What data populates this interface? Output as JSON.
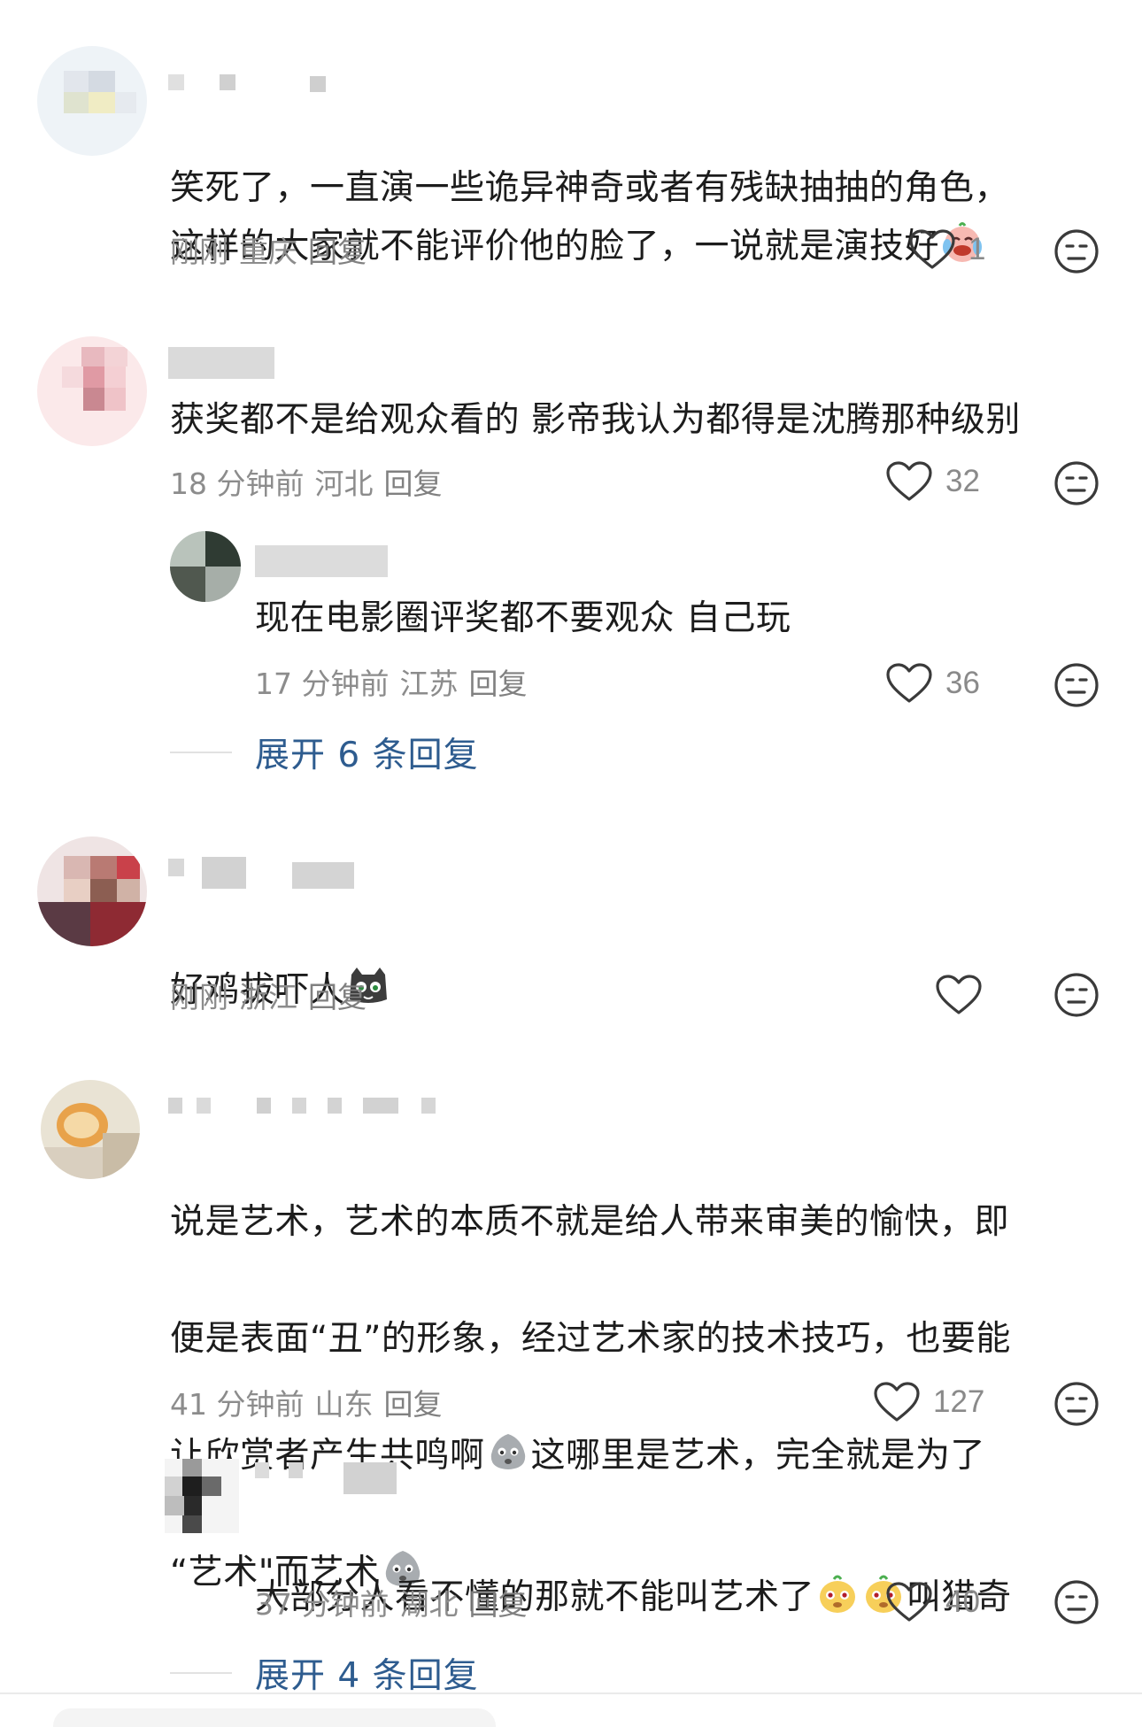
{
  "comments": [
    {
      "text": "笑死了，一直演一些诡异神奇或者有残缺抽抽的角色，\n这样的大家就不能评价他的脸了，一说就是演技好",
      "time": "刚刚",
      "location": "重庆",
      "reply_label": "回复",
      "likes": "1",
      "emoji": "crying-laugh-icon"
    },
    {
      "text": "获奖都不是给观众看的 影帝我认为都得是沈腾那种级别",
      "time": "18 分钟前",
      "location": "河北",
      "reply_label": "回复",
      "likes": "32",
      "reply": {
        "text": "现在电影圈评奖都不要观众 自己玩",
        "time": "17 分钟前",
        "location": "江苏",
        "reply_label": "回复",
        "likes": "36"
      },
      "expand_label": "展开 6 条回复"
    },
    {
      "text": "好鸡拔吓人",
      "time": "刚刚",
      "location": "浙江",
      "reply_label": "回复",
      "likes": "",
      "emoji": "cat-face-icon"
    },
    {
      "text_lines": [
        "说是艺术，艺术的本质不就是给人带来审美的愉快，即",
        "便是表面“丑”的形象，经过艺术家的技术技巧，也要能",
        "让欣赏者产生共鸣啊",
        "这哪里是艺术，完全就是为了",
        "“艺术\"而艺术"
      ],
      "time": "41 分钟前",
      "location": "山东",
      "reply_label": "回复",
      "likes": "127",
      "emoji": "gray-blob-icon",
      "reply": {
        "text_a": "大部分人看不懂的那就不能叫艺术了",
        "text_b": "叫猎奇",
        "time": "37 分钟前",
        "location": "湖北",
        "reply_label": "回复",
        "likes": "40",
        "emoji": "yellow-face-icon"
      },
      "expand_label": "展开 4 条回复"
    }
  ],
  "colors": {
    "link": "#2e5c8f",
    "meta": "#8c8c8c",
    "text": "#1c1c1c"
  }
}
